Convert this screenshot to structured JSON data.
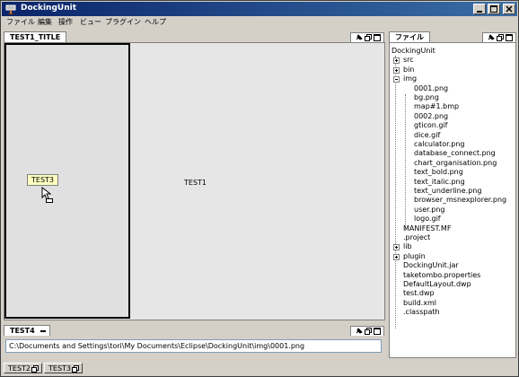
{
  "window": {
    "title": "DockingUnit"
  },
  "menu": [
    "ファイル",
    "編集",
    "操作",
    "ビュー",
    "プラグイン",
    "ヘルプ"
  ],
  "left_panel": {
    "tab_label": "TEST1_TITLE",
    "center_text": "TEST1",
    "drag_tooltip": "TEST3"
  },
  "file_panel": {
    "tab_label": "ファイル",
    "tree": [
      {
        "label": "DockingUnit",
        "level": 0
      },
      {
        "label": "src",
        "level": 1,
        "expander": "plus"
      },
      {
        "label": "bin",
        "level": 1,
        "expander": "plus"
      },
      {
        "label": "img",
        "level": 1,
        "expander": "minus"
      },
      {
        "label": "0001.png",
        "level": 2
      },
      {
        "label": "bg.png",
        "level": 2
      },
      {
        "label": "map#1.bmp",
        "level": 2
      },
      {
        "label": "0002.png",
        "level": 2
      },
      {
        "label": "gticon.gif",
        "level": 2
      },
      {
        "label": "dice.gif",
        "level": 2
      },
      {
        "label": "calculator.png",
        "level": 2
      },
      {
        "label": "database_connect.png",
        "level": 2
      },
      {
        "label": "chart_organisation.png",
        "level": 2
      },
      {
        "label": "text_bold.png",
        "level": 2
      },
      {
        "label": "text_italic.png",
        "level": 2
      },
      {
        "label": "text_underline.png",
        "level": 2
      },
      {
        "label": "browser_msnexplorer.png",
        "level": 2
      },
      {
        "label": "user.png",
        "level": 2
      },
      {
        "label": "logo.gif",
        "level": 2
      },
      {
        "label": "MANIFEST.MF",
        "level": 1
      },
      {
        "label": ".project",
        "level": 1
      },
      {
        "label": "lib",
        "level": 1,
        "expander": "plus"
      },
      {
        "label": "plugin",
        "level": 1,
        "expander": "plus"
      },
      {
        "label": "DockingUnit.jar",
        "level": 1
      },
      {
        "label": "taketombo.properties",
        "level": 1
      },
      {
        "label": "DefaultLayout.dwp",
        "level": 1
      },
      {
        "label": "test.dwp",
        "level": 1
      },
      {
        "label": "build.xml",
        "level": 1
      },
      {
        "label": ".classpath",
        "level": 1
      }
    ]
  },
  "test4_panel": {
    "tab_label": "TEST4",
    "path_value": "C:\\Documents and Settings\\tori\\My Documents\\Eclipse\\DockingUnit\\img\\0001.png"
  },
  "bottom_tabs": [
    "TEST2",
    "TEST3"
  ],
  "colors": {
    "titlebar_start": "#0a246a",
    "titlebar_end": "#3a6ea5",
    "panel_bg": "#e6e6e6"
  },
  "icons": [
    "app-icon",
    "minimize-icon",
    "maximize-icon",
    "close-icon",
    "pin-icon",
    "maximize-panel-icon",
    "restore-icon",
    "move-cursor-icon"
  ]
}
